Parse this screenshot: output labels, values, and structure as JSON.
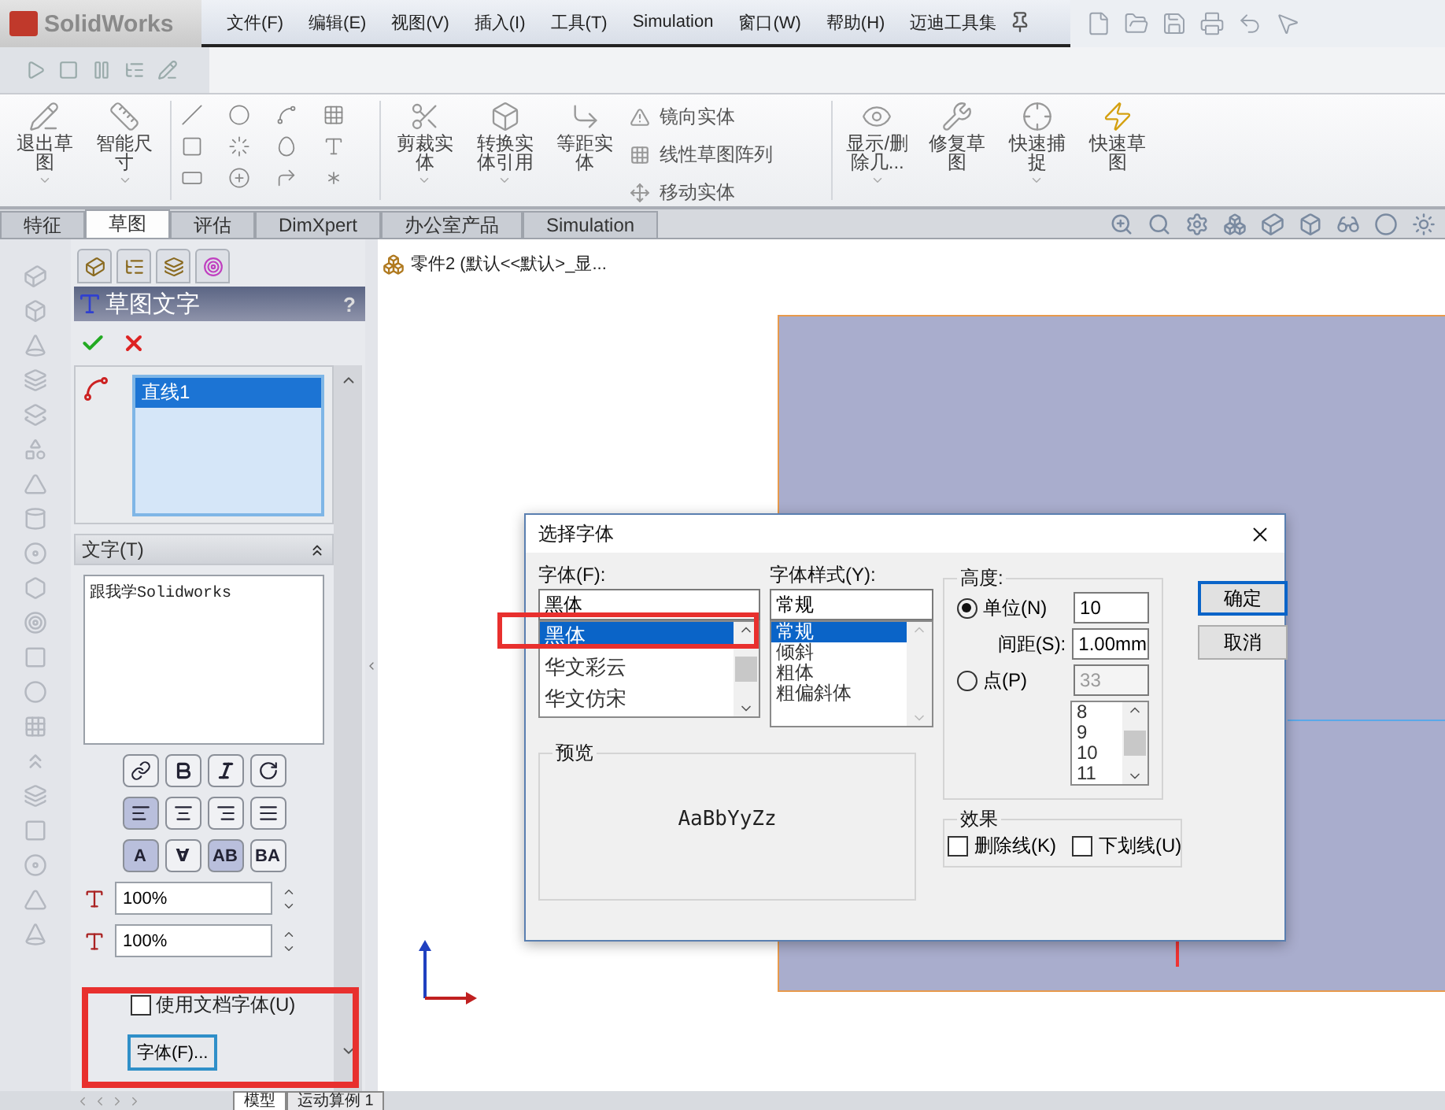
{
  "app": {
    "logo": "SolidWorks"
  },
  "menu": [
    "文件(F)",
    "编辑(E)",
    "视图(V)",
    "插入(I)",
    "工具(T)",
    "Simulation",
    "窗口(W)",
    "帮助(H)",
    "迈迪工具集"
  ],
  "ribbon": {
    "left": [
      {
        "label": "退出草图",
        "has_menu": true
      },
      {
        "label": "智能尺寸",
        "has_menu": true
      }
    ],
    "middle": [
      {
        "label": "剪裁实体",
        "has_menu": true
      },
      {
        "label": "转换实体引用",
        "has_menu": true
      },
      {
        "label": "等距实体",
        "has_menu": false
      }
    ],
    "list": [
      "镜向实体",
      "线性草图阵列",
      "移动实体"
    ],
    "right": [
      {
        "label": "显示/删除几...",
        "has_menu": true
      },
      {
        "label": "修复草图",
        "has_menu": false
      },
      {
        "label": "快速捕捉",
        "has_menu": true
      },
      {
        "label": "快速草图",
        "has_menu": false
      }
    ]
  },
  "tabs": [
    {
      "label": "特征",
      "selected": false
    },
    {
      "label": "草图",
      "selected": true
    },
    {
      "label": "评估",
      "selected": false
    },
    {
      "label": "DimXpert",
      "selected": false
    },
    {
      "label": "办公室产品",
      "selected": false
    },
    {
      "label": "Simulation",
      "selected": false
    }
  ],
  "property_manager": {
    "title": "草图文字",
    "help": "?",
    "entities": [
      {
        "label": "直线1",
        "selected": true
      }
    ],
    "text_section": "文字(T)",
    "text": "跟我学Solidworks",
    "align": [
      {
        "selected": true
      },
      {
        "selected": false
      },
      {
        "selected": false
      },
      {
        "selected": false
      }
    ],
    "flip": [
      {
        "label": "A",
        "selected": true
      },
      {
        "label": "∀",
        "selected": false
      },
      {
        "label": "AB",
        "selected": true
      },
      {
        "label": "BA",
        "selected": false
      }
    ],
    "width_factor": "100%",
    "spacing": "100%",
    "use_doc_font": {
      "label": "使用文档字体(U)",
      "checked": false
    },
    "font_button": "字体(F)..."
  },
  "tree": {
    "label": "零件2  (默认<<默认>_显..."
  },
  "dialog": {
    "title": "选择字体",
    "font_label": "字体(F):",
    "font_value": "黑体",
    "fonts": [
      {
        "name": "黑体",
        "selected": true
      },
      {
        "name": "华文彩云",
        "selected": false
      },
      {
        "name": "华文仿宋",
        "selected": false
      }
    ],
    "style_label": "字体样式(Y):",
    "style_value": "常规",
    "styles": [
      {
        "name": "常规",
        "selected": true
      },
      {
        "name": "倾斜",
        "selected": false
      },
      {
        "name": "粗体",
        "selected": false
      },
      {
        "name": "粗偏斜体",
        "selected": false
      }
    ],
    "height_label": "高度:",
    "units": {
      "label": "单位(N)",
      "selected": true,
      "value": "10"
    },
    "spacing": {
      "label": "间距(S):",
      "value": "1.00mm"
    },
    "points": {
      "label": "点(P)",
      "selected": false,
      "value": "33",
      "disabled": true,
      "sizes": [
        "8",
        "9",
        "10",
        "11"
      ]
    },
    "preview_label": "预览",
    "preview_text": "AaBbYyZz",
    "effects_label": "效果",
    "effects": [
      {
        "label": "删除线(K)",
        "checked": false
      },
      {
        "label": "下划线(U)",
        "checked": false
      }
    ],
    "buttons": [
      "确定",
      "取消"
    ]
  },
  "bottom_tabs": [
    {
      "label": "模型",
      "selected": true
    },
    {
      "label": "运动算例 1",
      "selected": false
    }
  ]
}
